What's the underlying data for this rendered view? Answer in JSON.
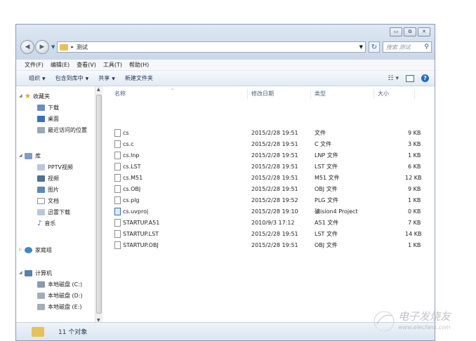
{
  "window": {
    "buttons": {
      "minimize": "▭",
      "maximize": "⧉",
      "close": "✕"
    }
  },
  "address": {
    "path": "测试",
    "search_placeholder": "搜索 测试"
  },
  "menu": [
    "文件(F)",
    "编辑(E)",
    "查看(V)",
    "工具(T)",
    "帮助(H)"
  ],
  "commands": [
    {
      "label": "组织",
      "dropdown": true
    },
    {
      "label": "包含到库中",
      "dropdown": true
    },
    {
      "label": "共享",
      "dropdown": true
    },
    {
      "label": "新建文件夹",
      "dropdown": false
    }
  ],
  "sidebar": {
    "favorites": {
      "label": "收藏夹",
      "items": [
        "下载",
        "桌面",
        "最近访问的位置"
      ]
    },
    "libraries": {
      "label": "库",
      "items": [
        "PPTV视频",
        "视频",
        "图片",
        "文档",
        "迅雷下载",
        "音乐"
      ]
    },
    "homegroup": {
      "label": "家庭组"
    },
    "computer": {
      "label": "计算机",
      "items": [
        "本地磁盘 (C:)",
        "本地磁盘 (D:)",
        "本地磁盘 (E:)"
      ]
    }
  },
  "columns": {
    "name": "名称",
    "date": "修改日期",
    "type": "类型",
    "size": "大小"
  },
  "files": [
    {
      "name": "cs",
      "date": "2015/2/28 19:51",
      "type": "文件",
      "size": "9 KB"
    },
    {
      "name": "cs.c",
      "date": "2015/2/28 19:51",
      "type": "C 文件",
      "size": "3 KB"
    },
    {
      "name": "cs.lnp",
      "date": "2015/2/28 19:51",
      "type": "LNP 文件",
      "size": "1 KB"
    },
    {
      "name": "cs.LST",
      "date": "2015/2/28 19:51",
      "type": "LST 文件",
      "size": "6 KB"
    },
    {
      "name": "cs.M51",
      "date": "2015/2/28 19:51",
      "type": "M51 文件",
      "size": "12 KB"
    },
    {
      "name": "cs.OBJ",
      "date": "2015/2/28 19:51",
      "type": "OBJ 文件",
      "size": "9 KB"
    },
    {
      "name": "cs.plg",
      "date": "2015/2/28 19:52",
      "type": "PLG 文件",
      "size": "1 KB"
    },
    {
      "name": "cs.uvproj",
      "date": "2015/2/28 19:10",
      "type": "礦ision4 Project",
      "size": "0 KB"
    },
    {
      "name": "STARTUP.A51",
      "date": "2010/9/3 17:12",
      "type": "A51 文件",
      "size": "7 KB"
    },
    {
      "name": "STARTUP.LST",
      "date": "2015/2/28 19:51",
      "type": "LST 文件",
      "size": "14 KB"
    },
    {
      "name": "STARTUP.OBJ",
      "date": "2015/2/28 19:51",
      "type": "OBJ 文件",
      "size": "1 KB"
    }
  ],
  "status": {
    "count": "11 个对象"
  },
  "watermark": {
    "text": "电子发烧友",
    "url": "www.elecfans.com",
    "brand": "Bai"
  },
  "colors": {
    "folder": "#e8c05a",
    "accent": "#2a67c2"
  }
}
